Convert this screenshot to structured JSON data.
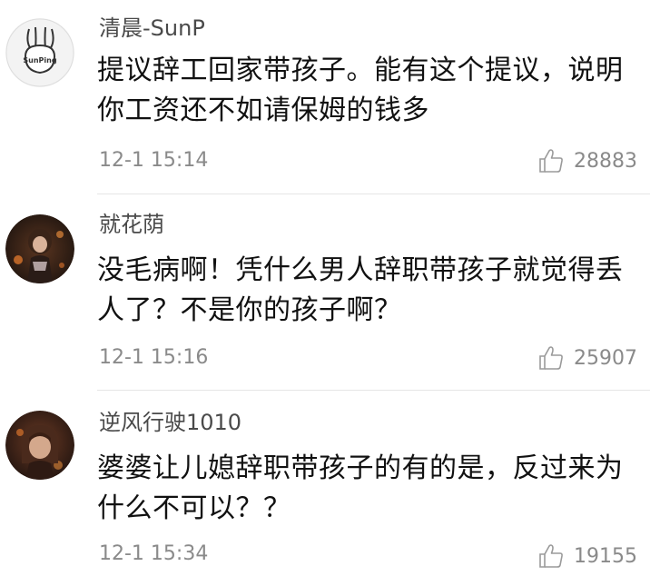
{
  "comments": [
    {
      "username": "清晨-SunP",
      "avatar_text": "SunPing",
      "text_lines": [
        "提议辞工回家带孩子。能有这个提议，说明",
        "你工资还不如请保姆的钱多"
      ],
      "time": "12-1 15:14",
      "likes": "28883"
    },
    {
      "username": "就花荫",
      "text_lines": [
        "没毛病啊！凭什么男人辞职带孩子就觉得丢",
        "人了？不是你的孩子啊？"
      ],
      "time": "12-1 15:16",
      "likes": "25907"
    },
    {
      "username": "逆风行驶1010",
      "text_lines": [
        "婆婆让儿媳辞职带孩子的有的是，反过来为",
        "什么不可以？？"
      ],
      "time": "12-1 15:34",
      "likes": "19155"
    }
  ],
  "icons": {
    "like": "thumbs-up-icon"
  }
}
